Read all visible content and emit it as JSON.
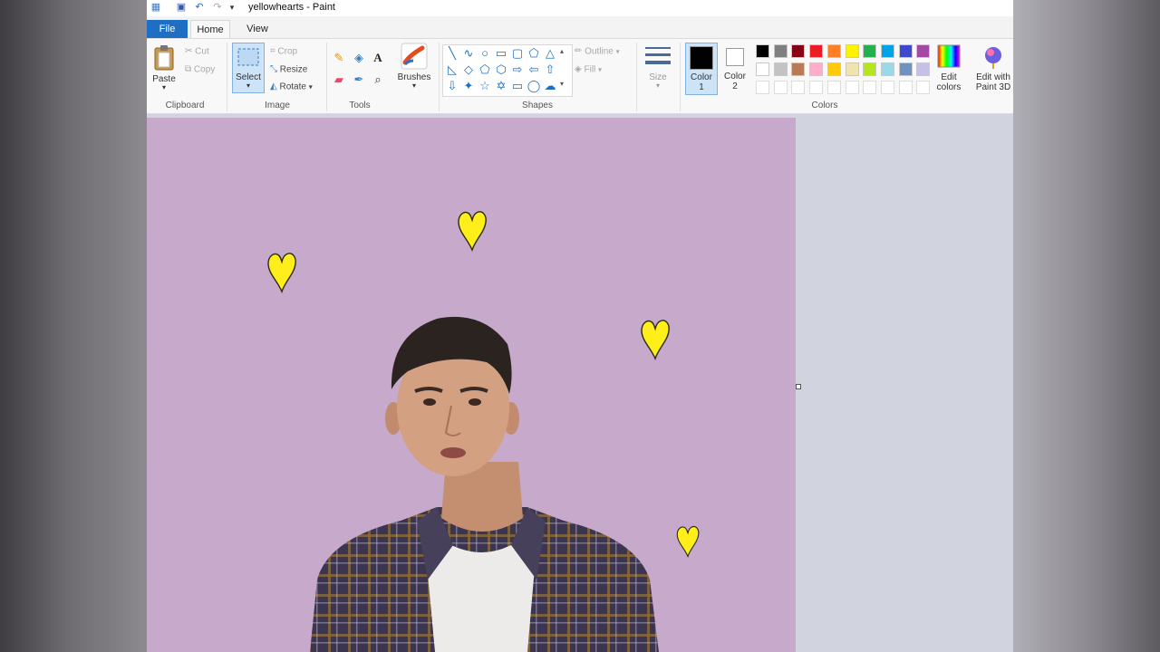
{
  "window": {
    "title": "yellowhearts - Paint"
  },
  "tabs": {
    "file": "File",
    "home": "Home",
    "view": "View"
  },
  "clipboard": {
    "paste": "Paste",
    "cut": "Cut",
    "copy": "Copy",
    "group": "Clipboard"
  },
  "image": {
    "select": "Select",
    "crop": "Crop",
    "resize": "Resize",
    "rotate": "Rotate",
    "group": "Image"
  },
  "tools": {
    "group": "Tools"
  },
  "brushes": {
    "label": "Brushes"
  },
  "shapes": {
    "outline": "Outline",
    "fill": "Fill",
    "group": "Shapes"
  },
  "size": {
    "label": "Size"
  },
  "colors": {
    "color1_label": "Color",
    "color1_num": "1",
    "color2_label": "Color",
    "color2_num": "2",
    "color1_value": "#000000",
    "color2_value": "#ffffff",
    "edit_label": "Edit",
    "edit_label2": "colors",
    "paint3d_label": "Edit with",
    "paint3d_label2": "Paint 3D",
    "group": "Colors",
    "palette_row1": [
      "#000000",
      "#7f7f7f",
      "#880015",
      "#ed1c24",
      "#ff7f27",
      "#fff200",
      "#22b14c",
      "#00a2e8",
      "#3f48cc",
      "#a349a4"
    ],
    "palette_row2": [
      "#ffffff",
      "#c3c3c3",
      "#b97a57",
      "#ffaec9",
      "#ffc90e",
      "#efe4b0",
      "#b5e61d",
      "#99d9ea",
      "#7092be",
      "#c8bfe7"
    ]
  },
  "canvas": {
    "background": "#c6a9cb",
    "heart_color": "#ffee1a"
  }
}
